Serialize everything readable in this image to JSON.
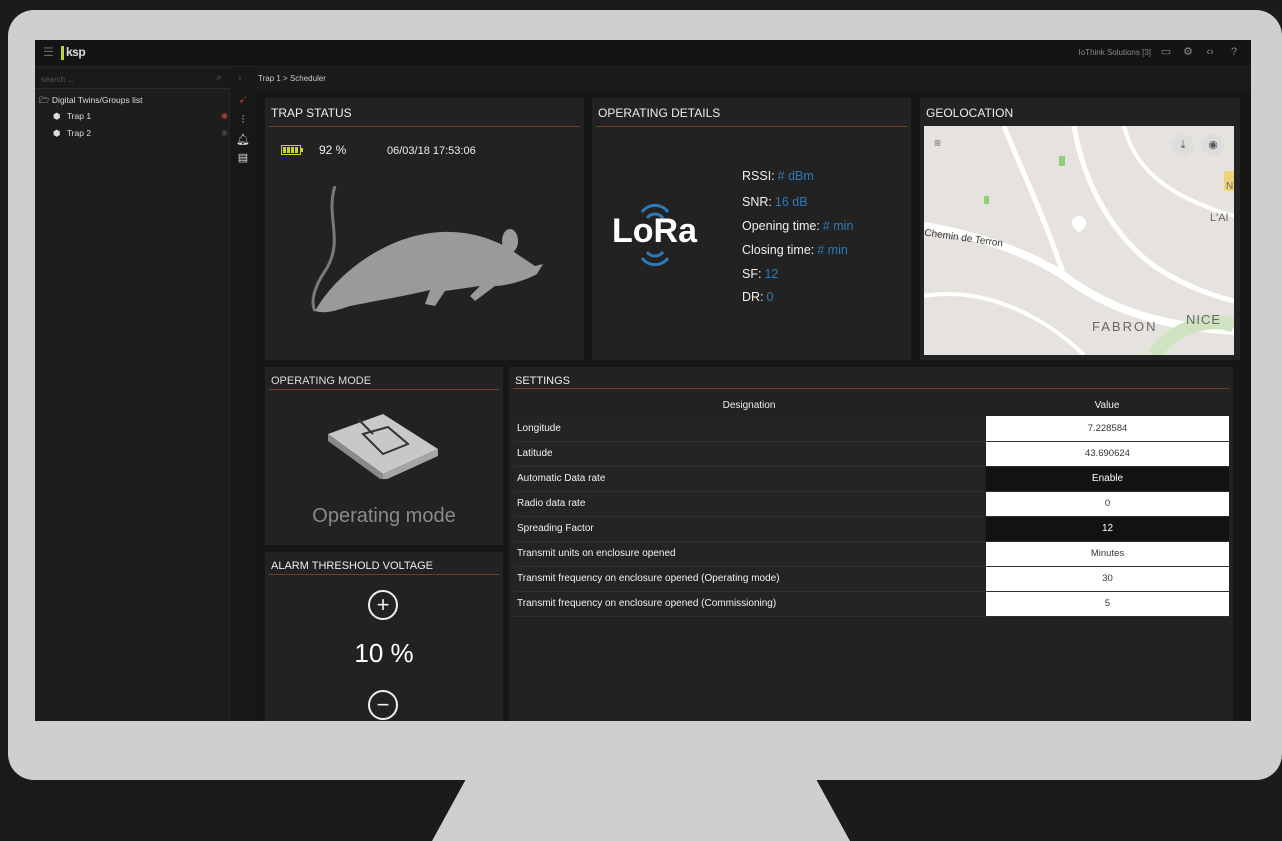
{
  "app": {
    "logo_text": "ksp",
    "tenant": "IoThink Solutions [3]"
  },
  "topbar_icons": [
    "monitor-icon",
    "settings-icon",
    "code-icon",
    "help-icon"
  ],
  "sidebar": {
    "search_placeholder": "search ...",
    "root_label": "Digital Twins/Groups list",
    "items": [
      {
        "label": "Trap 1"
      },
      {
        "label": "Trap 2"
      }
    ]
  },
  "breadcrumb": "Trap 1 > Scheduler",
  "trap_status": {
    "title": "TRAP STATUS",
    "battery": "92 %",
    "battery_level": 0.92,
    "timestamp": "06/03/18 17:53:06"
  },
  "operating_details": {
    "title": "OPERATING DETAILS",
    "logo": "LoRa",
    "rows": [
      {
        "label": "RSSI:",
        "value": "# dBm"
      },
      {
        "label": "SNR:",
        "value": "16 dB"
      },
      {
        "label": "Opening time:",
        "value": "# min"
      },
      {
        "label": "Closing time:",
        "value": "# min"
      },
      {
        "label": "SF:",
        "value": "12"
      },
      {
        "label": "DR:",
        "value": "0"
      }
    ]
  },
  "geolocation": {
    "title": "GEOLOCATION",
    "labels": {
      "road": "Chemin de Terron",
      "area": "FABRON",
      "city": "NICE",
      "edge1": "L'AI",
      "edge2": "N"
    }
  },
  "operating_mode": {
    "title": "OPERATING MODE",
    "caption": "Operating mode"
  },
  "alarm": {
    "title": "ALARM THRESHOLD VOLTAGE",
    "value": "10 %"
  },
  "settings": {
    "title": "SETTINGS",
    "col_designation": "Designation",
    "col_value": "Value",
    "rows": [
      {
        "designation": "Longitude",
        "value": "7.228584"
      },
      {
        "designation": "Latitude",
        "value": "43.690624"
      },
      {
        "designation": "Automatic Data rate",
        "value": "Enable"
      },
      {
        "designation": "Radio data rate",
        "value": "0"
      },
      {
        "designation": "Spreading Factor",
        "value": "12"
      },
      {
        "designation": "Transmit units on enclosure opened",
        "value": "Minutes"
      },
      {
        "designation": "Transmit frequency on enclosure opened (Operating mode)",
        "value": "30"
      },
      {
        "designation": "Transmit frequency on enclosure opened (Commissioning)",
        "value": "5"
      }
    ]
  },
  "colors": {
    "accent_line": "#7a3a2a",
    "lora_value": "#2e7ab8",
    "battery": "#c8d820",
    "logo_bar": "#b8d530"
  }
}
